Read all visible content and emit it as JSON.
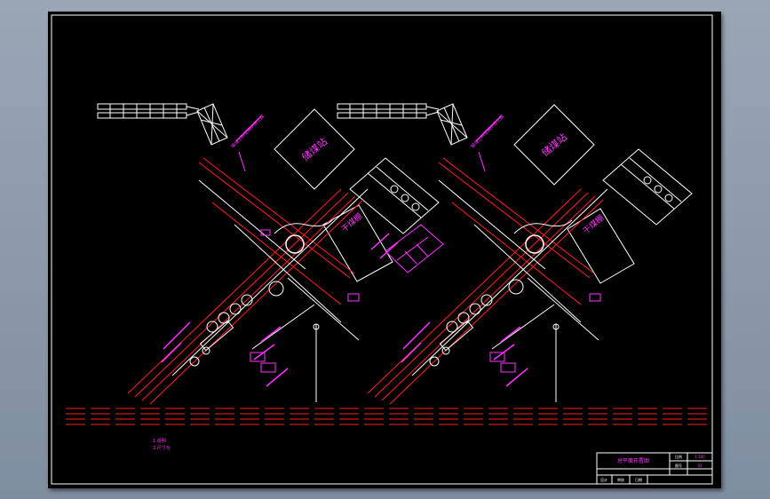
{
  "drawing": {
    "left_station": {
      "coal_yard_label": "储煤站",
      "dry_yard_label": "干煤棚",
      "leader_label": "输煤上料至锅炉房上煤"
    },
    "right_station": {
      "coal_yard_label": "储煤站",
      "dry_yard_label": "干煤棚",
      "leader_label": "输煤上料至锅炉房上煤"
    },
    "notes": {
      "line1": "1.说明",
      "line2": "2.尺寸为"
    }
  },
  "title_block": {
    "drawing_title": "总平面布置图",
    "cell_scale_label": "比例",
    "cell_scale_value": "1:500",
    "cell_sheet_label": "图号",
    "cell_sheet_value": "01",
    "cell_designer": "设计",
    "cell_checker": "审核",
    "cell_date": "日期"
  },
  "colors": {
    "background": "#000000",
    "line_white": "#ffffff",
    "line_red": "#ff2020",
    "text_magenta": "#ff33ff",
    "hatch_red": "#cc1010"
  }
}
